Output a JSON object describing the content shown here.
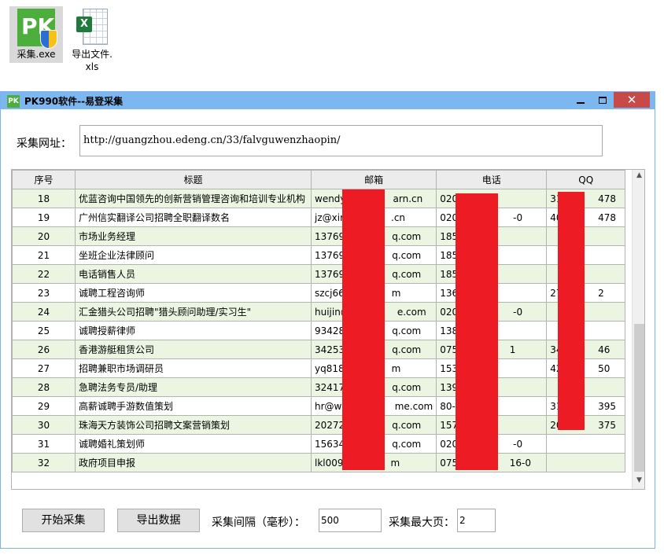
{
  "desktop": {
    "icons": [
      {
        "label": "采集.exe"
      },
      {
        "label_line1": "导出文件.",
        "label_line2": "xls"
      }
    ]
  },
  "window": {
    "title": "PK990软件--易登采集",
    "app_icon_text": "PK",
    "close_glyph": "✕"
  },
  "form": {
    "url_label": "采集网址：",
    "url_value": "http://guangzhou.edeng.cn/33/falvguwenzhaopin/",
    "interval_label": "采集间隔（毫秒）：",
    "interval_value": "500",
    "maxpage_label": "采集最大页：",
    "maxpage_value": "2",
    "start_button": "开始采集",
    "export_button": "导出数据"
  },
  "grid": {
    "headers": [
      "序号",
      "标题",
      "邮箱",
      "电话",
      "QQ"
    ],
    "rows": [
      [
        "18",
        "优蓝咨询中国领先的创新营销管理咨询和培训专业机构",
        "wendy",
        "arn.cn",
        "020-2",
        "",
        "312",
        "478"
      ],
      [
        "19",
        "广州信实翻译公司招聘全职翻译数名",
        "jz@xir",
        ".cn",
        "020-3",
        "-0",
        "400",
        "478"
      ],
      [
        "20",
        "市场业务经理",
        "13769",
        "q.com",
        "1850",
        "",
        "",
        ""
      ],
      [
        "21",
        "坐班企业法律顾问",
        "13769",
        "q.com",
        "1850",
        "",
        "",
        ""
      ],
      [
        "22",
        "电话销售人员",
        "13769",
        "q.com",
        "1850",
        "",
        "",
        ""
      ],
      [
        "23",
        "诚聘工程咨询师",
        "szcj66",
        "m",
        "1363",
        "",
        "275",
        "2"
      ],
      [
        "24",
        "汇金猎头公司招聘\"猎头顾问助理/实习生\"",
        "huijin@",
        "e.com",
        "020-6",
        "-0",
        "",
        ""
      ],
      [
        "25",
        "诚聘授薪律师",
        "93428",
        "q.com",
        "1382",
        "",
        "",
        ""
      ],
      [
        "26",
        "香港游艇租赁公司",
        "34253",
        "q.com",
        "0755",
        "1",
        "342",
        "46"
      ],
      [
        "27",
        "招聘兼职市场调研员",
        "yq818",
        "m",
        "1535",
        "",
        "422",
        "50"
      ],
      [
        "28",
        "急聘法务专员/助理",
        "32417",
        "q.com",
        "1392",
        "",
        "",
        ""
      ],
      [
        "29",
        "高薪诚聘手游数值策划",
        "hr@wa",
        "me.com",
        "80-02",
        "",
        "313",
        "395"
      ],
      [
        "30",
        "珠海天方装饰公司招聘文案营销策划",
        "20272",
        "q.com",
        "1576",
        "",
        "202",
        "375"
      ],
      [
        "31",
        "诚聘婚礼策划师",
        "15634",
        "q.com",
        "020-2",
        "-0",
        "",
        ""
      ],
      [
        "32",
        "政府项目申报",
        "lkl009",
        "m",
        "0755",
        "16-0",
        "",
        ""
      ]
    ]
  },
  "colors": {
    "titlebar": "#7cb7f0",
    "row_alt": "#ebf5e1",
    "redaction": "#ed1c24",
    "close_button": "#c74a48"
  }
}
